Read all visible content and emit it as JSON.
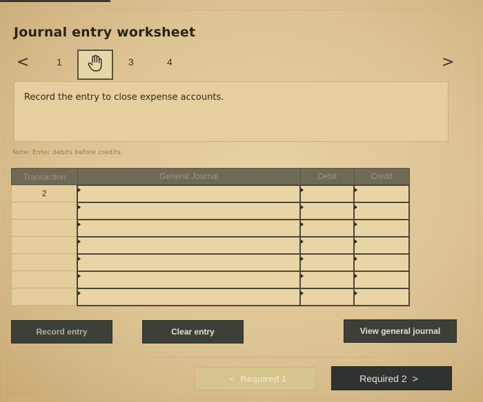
{
  "worksheet": {
    "title": "Journal entry worksheet",
    "steps": [
      "1",
      "2",
      "3",
      "4"
    ],
    "active_step": 2,
    "prev_arrow": "<",
    "next_arrow": ">",
    "instruction": "Record the entry to close expense accounts.",
    "note": "Note: Enter debits before credits."
  },
  "journal_table": {
    "headers": {
      "transaction": "Transaction",
      "general_journal": "General Journal",
      "debit": "Debit",
      "credit": "Credit"
    },
    "rows": [
      {
        "transaction": "2",
        "account": "",
        "debit": "",
        "credit": ""
      },
      {
        "transaction": "",
        "account": "",
        "debit": "",
        "credit": ""
      },
      {
        "transaction": "",
        "account": "",
        "debit": "",
        "credit": ""
      },
      {
        "transaction": "",
        "account": "",
        "debit": "",
        "credit": ""
      },
      {
        "transaction": "",
        "account": "",
        "debit": "",
        "credit": ""
      },
      {
        "transaction": "",
        "account": "",
        "debit": "",
        "credit": ""
      },
      {
        "transaction": "",
        "account": "",
        "debit": "",
        "credit": ""
      }
    ]
  },
  "actions": {
    "record_entry": "Record entry",
    "clear_entry": "Clear entry",
    "view_general_journal": "View general journal"
  },
  "footer_nav": {
    "prev_label": "Required 1",
    "prev_chevron": "<",
    "next_label": "Required 2",
    "next_chevron": ">"
  },
  "icons": {
    "active_step_icon": "hand-pointer-icon"
  },
  "colors": {
    "header_bg": "#6e6a55",
    "button_dark": "#3d4038",
    "required2_bg": "#2f3432"
  }
}
